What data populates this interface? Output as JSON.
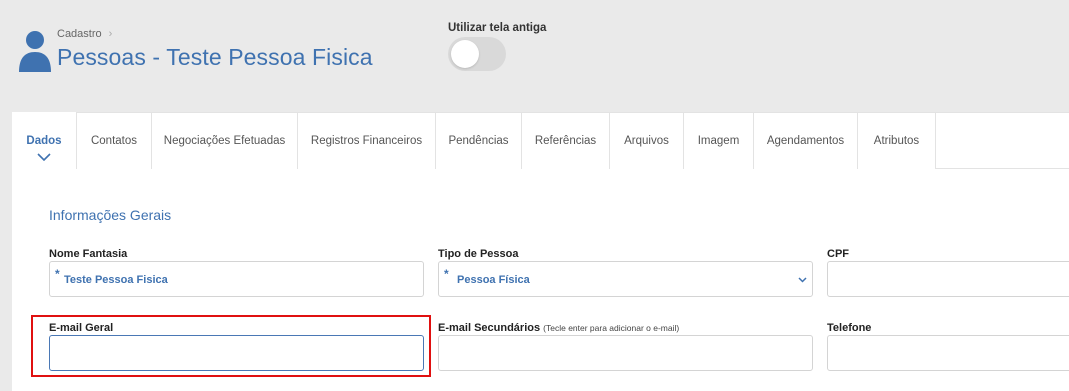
{
  "header": {
    "breadcrumb": "Cadastro",
    "title": "Pessoas - Teste Pessoa Fisica",
    "old_screen_label": "Utilizar tela antiga"
  },
  "tabs": [
    {
      "label": "Dados"
    },
    {
      "label": "Contatos"
    },
    {
      "label": "Negociações Efetuadas"
    },
    {
      "label": "Registros Financeiros"
    },
    {
      "label": "Pendências"
    },
    {
      "label": "Referências"
    },
    {
      "label": "Arquivos"
    },
    {
      "label": "Imagem"
    },
    {
      "label": "Agendamentos"
    },
    {
      "label": "Atributos"
    }
  ],
  "form": {
    "section_title": "Informações Gerais",
    "nome_fantasia": {
      "label": "Nome Fantasia",
      "value": "Teste Pessoa Fisica",
      "required": "*"
    },
    "tipo_pessoa": {
      "label": "Tipo de Pessoa",
      "value": "Pessoa Física",
      "required": "*"
    },
    "cpf": {
      "label": "CPF",
      "value": ""
    },
    "email_geral": {
      "label": "E-mail Geral",
      "value": ""
    },
    "email_secundarios": {
      "label": "E-mail Secundários",
      "hint": "(Tecle enter para adicionar o e-mail)",
      "value": ""
    },
    "telefone": {
      "label": "Telefone",
      "value": ""
    }
  },
  "colors": {
    "accent": "#3f72b0",
    "highlight": "#e01010"
  }
}
